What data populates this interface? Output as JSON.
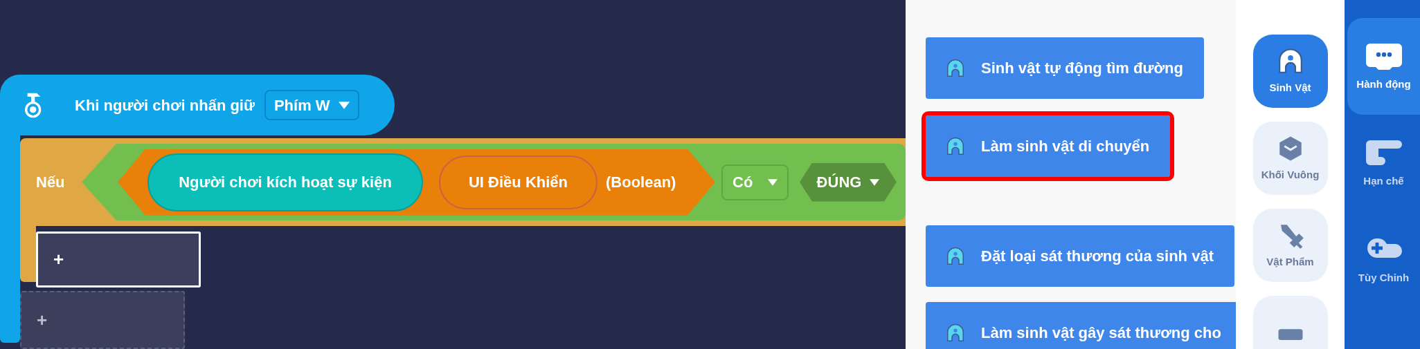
{
  "event_block": {
    "label": "Khi người chơi nhấn giữ",
    "dropdown": "Phím W"
  },
  "if_block": {
    "label": "Nếu",
    "condition": {
      "event_pill": "Người chơi kích hoạt sự kiện",
      "ui_pill": "UI Điều Khiển",
      "type_label": "(Boolean)",
      "operator": "Có",
      "value": "ĐÚNG"
    },
    "slots": [
      {
        "label": "+",
        "selected": true
      },
      {
        "label": "+",
        "selected": false
      }
    ]
  },
  "flyout_blocks": [
    {
      "label": "Sinh vật tự động tìm đường",
      "highlighted": false
    },
    {
      "label": "Làm sinh vật di chuyển",
      "highlighted": true
    },
    {
      "label": "Đặt loại sát thương của sinh vật",
      "highlighted": false
    },
    {
      "label": "Làm sinh vật gây sát thương cho",
      "highlighted": false
    }
  ],
  "categories": [
    {
      "kind": "creature",
      "label": "Sinh Vật",
      "selected": true
    },
    {
      "kind": "cube",
      "label": "Khối Vuông",
      "selected": false
    },
    {
      "kind": "item",
      "label": "Vật Phẩm",
      "selected": false
    },
    {
      "kind": "card",
      "selected": false
    }
  ],
  "rail": [
    {
      "kind": "action",
      "label": "Hành động",
      "selected": true
    },
    {
      "kind": "limit",
      "label": "Hạn chế",
      "selected": false
    },
    {
      "kind": "custom",
      "label": "Tùy Chỉnh",
      "selected": false
    }
  ]
}
